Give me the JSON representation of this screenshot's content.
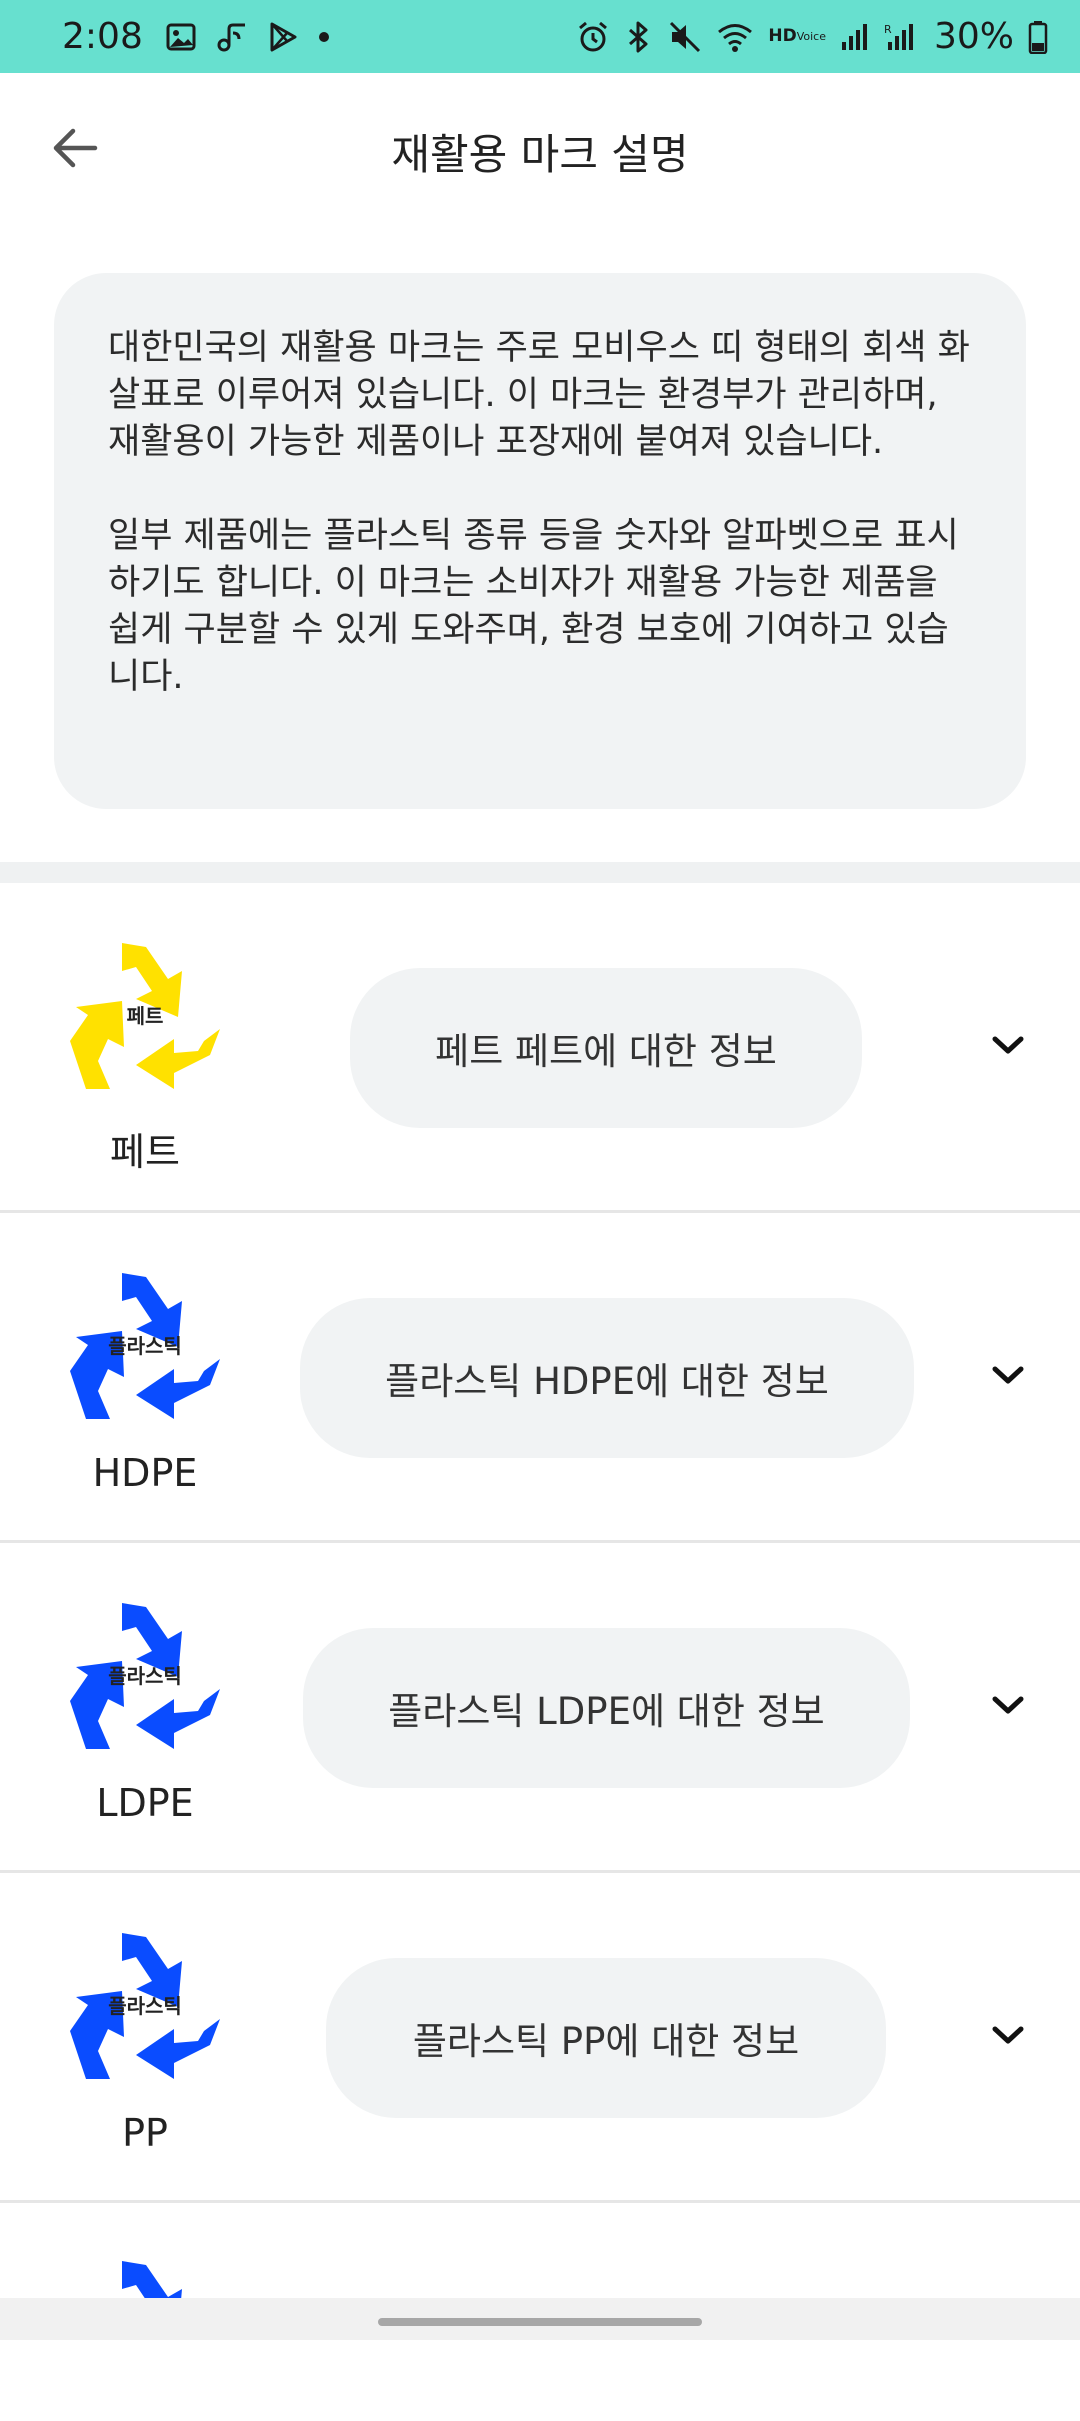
{
  "status_bar": {
    "time": "2:08",
    "battery": "30%",
    "hd_label": "HD",
    "voice_label": "Voice",
    "left_icons": [
      "image-icon",
      "music-share-icon",
      "play-store-icon",
      "dot-icon"
    ],
    "right_icons": [
      "alarm-icon",
      "bluetooth-icon",
      "mute-icon",
      "wifi-icon",
      "hd-voice-icon",
      "signal-icon",
      "signal-roaming-icon",
      "battery-icon"
    ],
    "color": "#67e0cf"
  },
  "app_bar": {
    "title": "재활용 마크 설명",
    "back_icon": "arrow-left-icon"
  },
  "intro": {
    "paragraphs": [
      "대한민국의 재활용 마크는 주로 모비우스 띠 형태의 회색 화살표로 이루어져 있습니다. 이 마크는 환경부가 관리하며, 재활용이 가능한 제품이나 포장재에 붙여져 있습니다.",
      "일부 제품에는 플라스틱 종류 등을 숫자와 알파벳으로 표시하기도 합니다. 이 마크는 소비자가 재활용 가능한 제품을 쉽게 구분할 수 있게 도와주며, 환경 보호에 기여하고 있습니다."
    ]
  },
  "items": [
    {
      "mark_text": "페트",
      "label": "페트",
      "info_button": "페트 페트에 대한 정보",
      "color": "#ffe100"
    },
    {
      "mark_text": "플라스틱",
      "label": "HDPE",
      "info_button": "플라스틱 HDPE에 대한 정보",
      "color": "#0a4cff"
    },
    {
      "mark_text": "플라스틱",
      "label": "LDPE",
      "info_button": "플라스틱 LDPE에 대한 정보",
      "color": "#0a4cff"
    },
    {
      "mark_text": "플라스틱",
      "label": "PP",
      "info_button": "플라스틱 PP에 대한 정보",
      "color": "#0a4cff"
    }
  ],
  "partial_item": {
    "color": "#0a4cff"
  }
}
